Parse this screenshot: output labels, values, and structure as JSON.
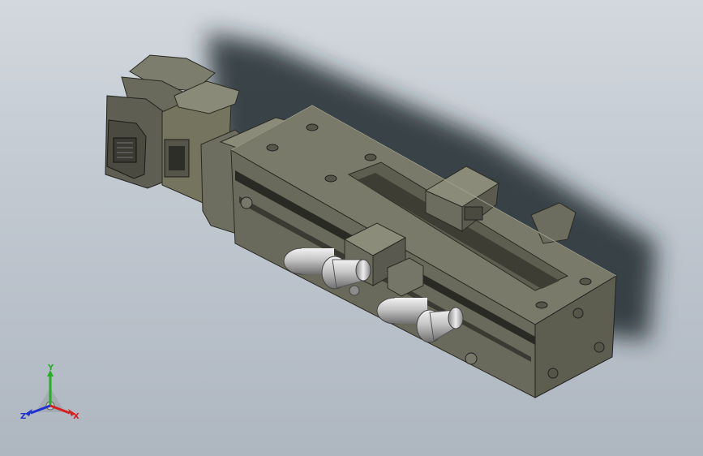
{
  "viewport": {
    "background_top": "#d3d8de",
    "background_bottom": "#aeb6c0"
  },
  "model": {
    "body_color": "#6d6d5f",
    "body_light": "#8a8a7a",
    "body_dark": "#4a4a40",
    "metal_color": "#c8c8c8"
  },
  "triad": {
    "x_label": "X",
    "y_label": "Y",
    "z_label": "Z",
    "x_color": "#d42020",
    "y_color": "#20b020",
    "z_color": "#2030d0"
  }
}
